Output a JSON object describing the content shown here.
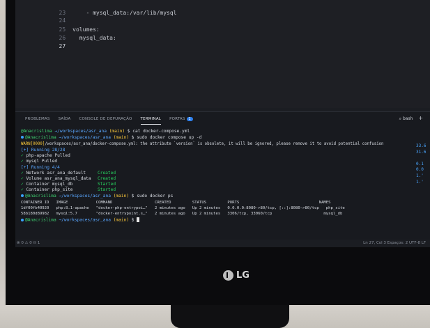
{
  "editor": {
    "lines": [
      {
        "num": "23",
        "code": "    - mysql_data:/var/lib/mysql"
      },
      {
        "num": "24",
        "code": ""
      },
      {
        "num": "25",
        "code": "volumes:"
      },
      {
        "num": "26",
        "code": "  mysql_data:"
      },
      {
        "num": "27",
        "code": ""
      }
    ]
  },
  "panel": {
    "tabs": [
      "PROBLEMAS",
      "SAÍDA",
      "CONSOLE DE DEPURAÇÃO",
      "TERMINAL",
      "PORTAS"
    ],
    "ports_badge": "1",
    "shell": "bash",
    "plus": "+"
  },
  "terminal": {
    "user": "@Anacrislima",
    "path": "/workspaces/asr_ana",
    "branch": "(main)",
    "cmd1": "$ cat docker-compose.yml",
    "cmd2": "$ sudo docker compose up -d",
    "warn_tag": "WARN[0000]",
    "warn_text": "/workspaces/asr_ana/docker-compose.yml: the attribute `version` is obsolete, it will be ignored, please remove it to avoid potential confusion",
    "running1": "[+] Running 28/28",
    "pull1": " php-apache Pulled",
    "pull2": " mysql Pulled",
    "running2": "[+] Running 4/4",
    "res": [
      {
        "name": " Network asr_ana_default",
        "status": "Created"
      },
      {
        "name": " Volume asr_ana_mysql_data",
        "status": "Created"
      },
      {
        "name": " Container mysql_db",
        "status": "Started"
      },
      {
        "name": " Container php_site",
        "status": "Started"
      }
    ],
    "cmd3": "$ sudo docker ps",
    "ps_header": "CONTAINER ID   IMAGE            COMMAND                  CREATED         STATUS         PORTS                                  NAMES",
    "ps_row1": "1df00fb40920   php:8.1-apache   \"docker-php-entrypoi…\"   2 minutes ago   Up 2 minutes   0.0.0.0:8080->80/tcp, [::]:8080->80/tcp   php_site",
    "ps_row2": "58b180d89982   mysql:5.7        \"docker-entrypoint.s…\"   2 minutes ago   Up 2 minutes   3306/tcp, 33060/tcp                      mysql_db",
    "right_nums": "33.6\n31.6\n\n0.1\n0.0\n1.'\n1.'"
  },
  "statusbar": {
    "left": "⊗ 0 ⚠ 0   ⛁ 1",
    "right": "Ln 27, Col 3   Espaços: 2   UTF-8   LF"
  },
  "brand": "LG"
}
